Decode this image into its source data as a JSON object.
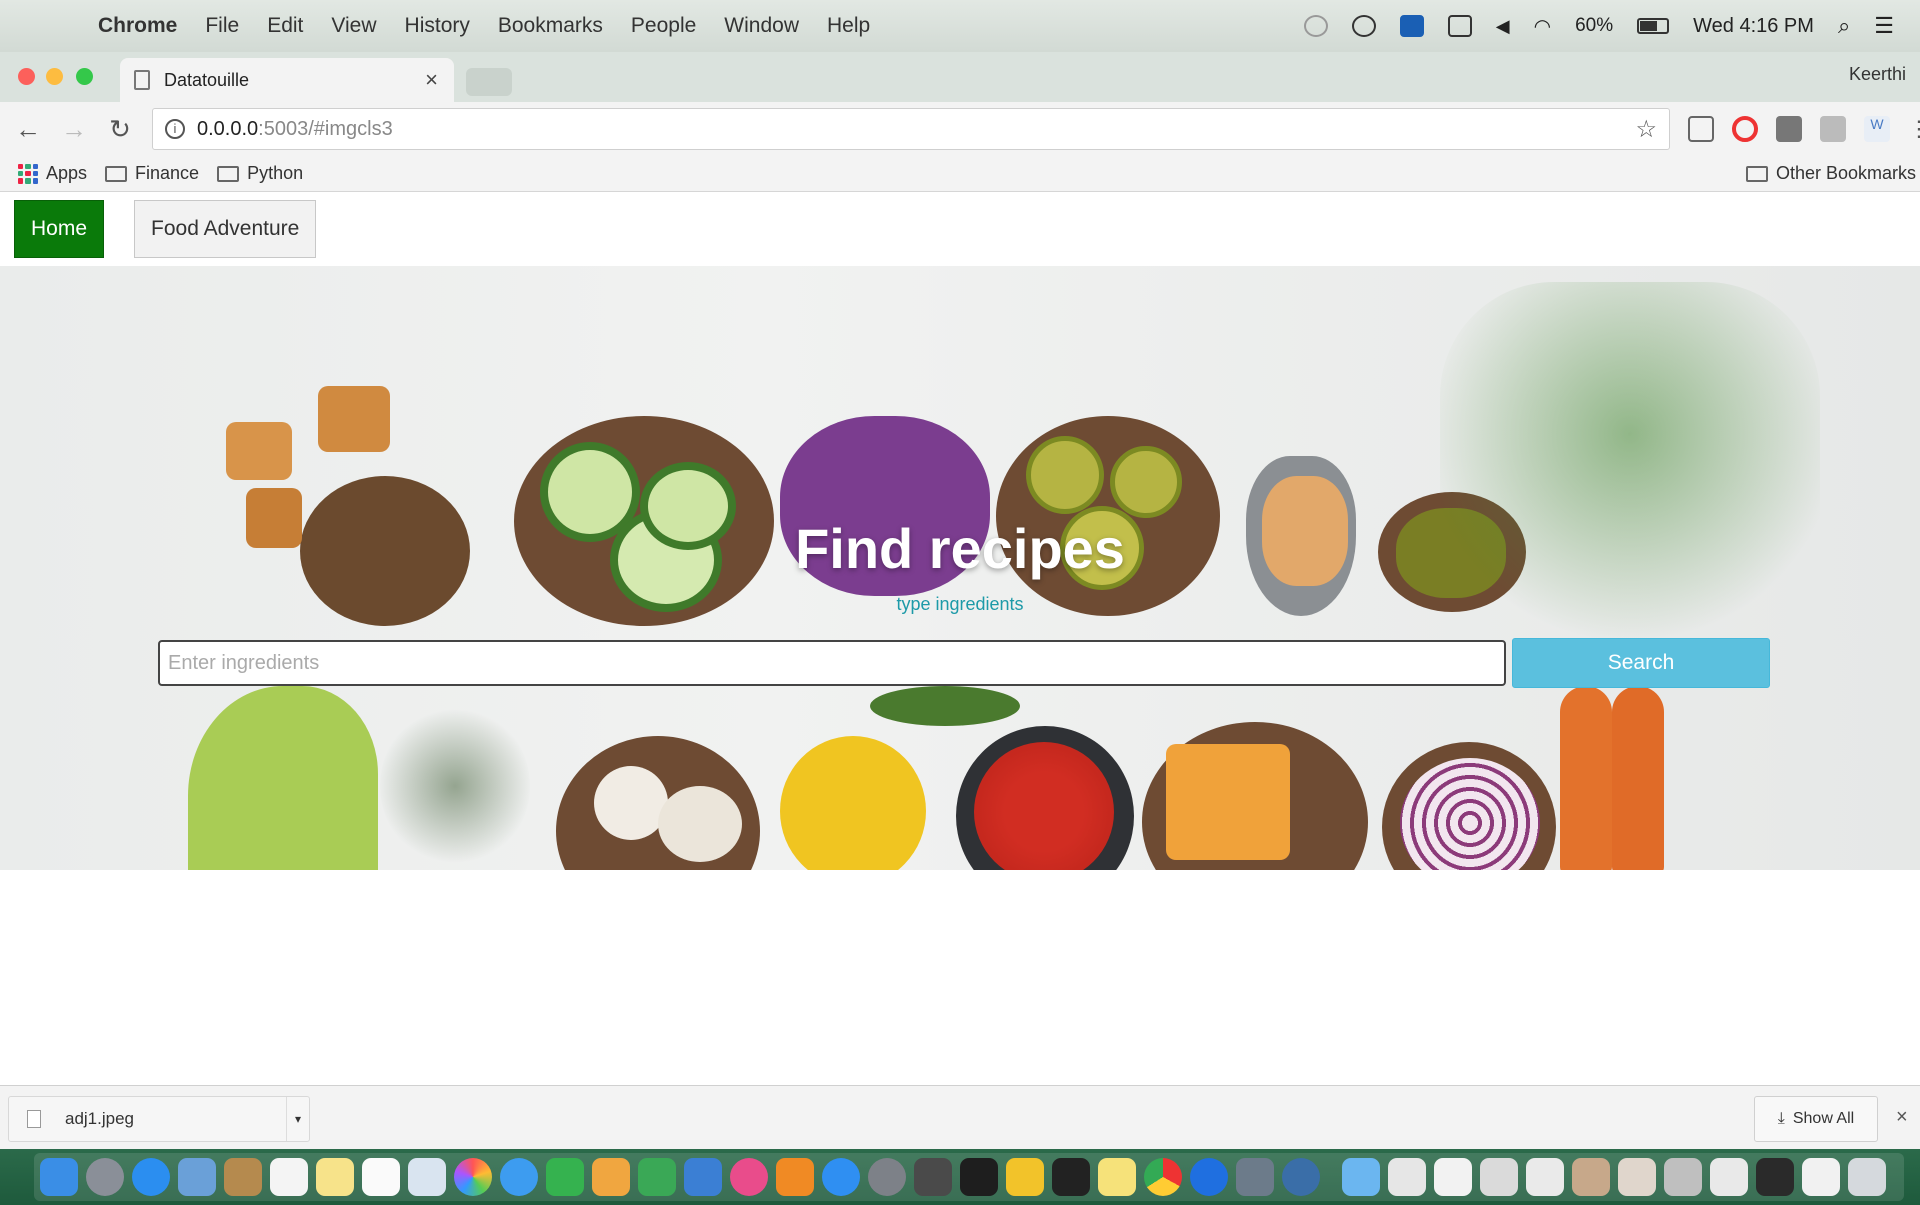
{
  "menubar": {
    "apple": "",
    "app": "Chrome",
    "items": [
      "File",
      "Edit",
      "View",
      "History",
      "Bookmarks",
      "People",
      "Window",
      "Help"
    ],
    "battery": "60%",
    "clock": "Wed 4:16 PM"
  },
  "tabs": {
    "active_title": "Datatouille",
    "close": "×",
    "profile": "Keerthi"
  },
  "toolbar": {
    "url_host": "0.0.0.0",
    "url_path": ":5003/#imgcls3",
    "info": "i",
    "star": "☆"
  },
  "bookmarks": {
    "apps": "Apps",
    "items": [
      "Finance",
      "Python"
    ],
    "other": "Other Bookmarks"
  },
  "page": {
    "nav": {
      "home": "Home",
      "food_adventure": "Food Adventure"
    },
    "hero": {
      "title": "Find recipes",
      "subtitle": "type ingredients",
      "input_placeholder": "Enter ingredients",
      "search": "Search"
    }
  },
  "downloads": {
    "file": "adj1.jpeg",
    "show_all": "Show All",
    "close": "×"
  },
  "colors": {
    "home_button": "#0a7a0a",
    "search_button": "#5bc0de",
    "subtitle": "#1d9aa8"
  }
}
